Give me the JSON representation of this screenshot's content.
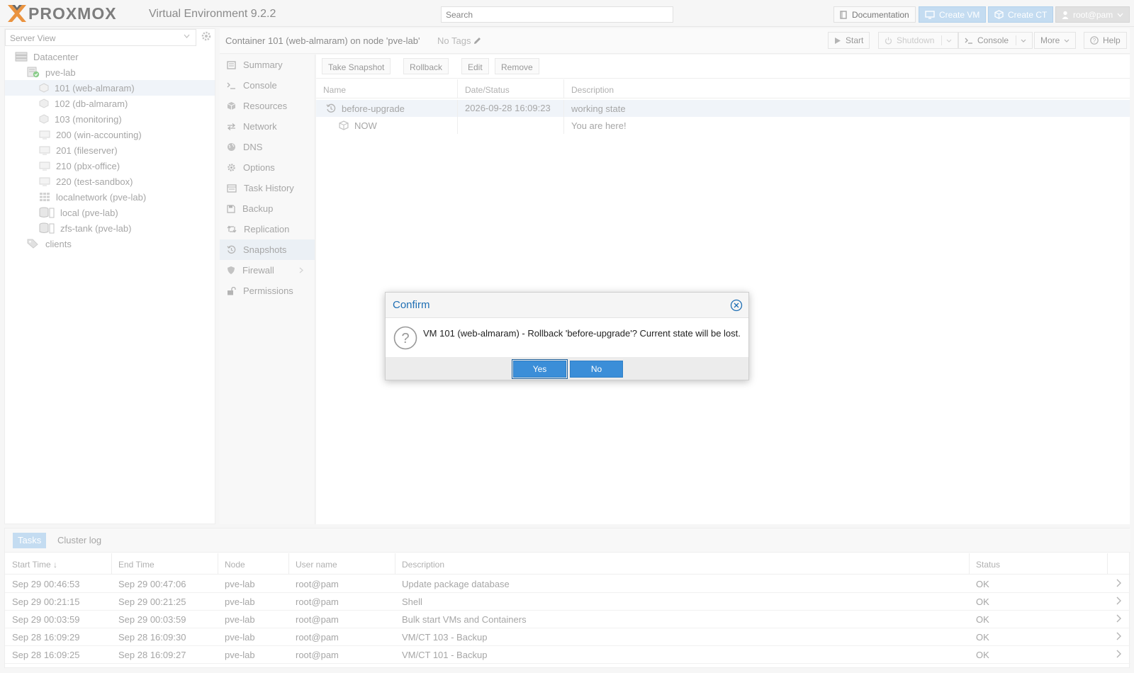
{
  "topbar": {
    "logo": "PROXMOX",
    "version": "Virtual Environment 9.2.2",
    "search_placeholder": "Search",
    "documentation": "Documentation",
    "create_vm": "Create VM",
    "create_ct": "Create CT",
    "user": "root@pam"
  },
  "left": {
    "view": "Server View",
    "tree": [
      {
        "label": "Datacenter",
        "icon": "datacenter-icon"
      },
      {
        "label": "pve-lab",
        "icon": "node-online-icon"
      },
      {
        "label": "101 (web-almaram)",
        "icon": "container-icon",
        "selected": true
      },
      {
        "label": "102 (db-almaram)",
        "icon": "container-icon"
      },
      {
        "label": "103 (monitoring)",
        "icon": "container-icon"
      },
      {
        "label": "200 (win-accounting)",
        "icon": "vm-icon"
      },
      {
        "label": "201 (fileserver)",
        "icon": "vm-icon"
      },
      {
        "label": "210 (pbx-office)",
        "icon": "vm-icon"
      },
      {
        "label": "220 (test-sandbox)",
        "icon": "vm-icon"
      },
      {
        "label": "localnetwork (pve-lab)",
        "icon": "sdn-icon"
      },
      {
        "label": "local (pve-lab)",
        "icon": "storage-icon"
      },
      {
        "label": "zfs-tank (pve-lab)",
        "icon": "storage-icon"
      },
      {
        "label": "clients",
        "icon": "tag-icon"
      }
    ]
  },
  "header": {
    "title": "Container 101 (web-almaram) on node 'pve-lab'",
    "no_tags": "No Tags",
    "start": "Start",
    "shutdown": "Shutdown",
    "console": "Console",
    "more": "More",
    "help": "Help"
  },
  "nav": [
    {
      "label": "Summary",
      "icon": "summary-icon"
    },
    {
      "label": "Console",
      "icon": "terminal-icon"
    },
    {
      "label": "Resources",
      "icon": "cube-icon"
    },
    {
      "label": "Network",
      "icon": "network-icon"
    },
    {
      "label": "DNS",
      "icon": "globe-icon"
    },
    {
      "label": "Options",
      "icon": "gear-icon"
    },
    {
      "label": "Task History",
      "icon": "list-icon"
    },
    {
      "label": "Backup",
      "icon": "floppy-icon"
    },
    {
      "label": "Replication",
      "icon": "retweet-icon"
    },
    {
      "label": "Snapshots",
      "icon": "history-icon",
      "active": true
    },
    {
      "label": "Firewall",
      "icon": "shield-icon"
    },
    {
      "label": "Permissions",
      "icon": "unlock-icon"
    }
  ],
  "snapshots": {
    "toolbar": {
      "take": "Take Snapshot",
      "rollback": "Rollback",
      "edit": "Edit",
      "remove": "Remove"
    },
    "columns": {
      "name": "Name",
      "date": "Date/Status",
      "description": "Description"
    },
    "rows": [
      {
        "name": "before-upgrade",
        "date": "2026-09-28 16:09:23",
        "description": "working state"
      },
      {
        "name": "NOW",
        "date": "",
        "description": "You are here!"
      }
    ]
  },
  "tasks": {
    "tabs": {
      "tasks": "Tasks",
      "cluster_log": "Cluster log"
    },
    "columns": {
      "start": "Start Time",
      "end": "End Time",
      "node": "Node",
      "user": "User name",
      "description": "Description",
      "status": "Status"
    },
    "rows": [
      {
        "start": "Sep 29 00:46:53",
        "end": "Sep 29 00:47:06",
        "node": "pve-lab",
        "user": "root@pam",
        "description": "Update package database",
        "status": "OK"
      },
      {
        "start": "Sep 29 00:21:15",
        "end": "Sep 29 00:21:25",
        "node": "pve-lab",
        "user": "root@pam",
        "description": "Shell",
        "status": "OK"
      },
      {
        "start": "Sep 29 00:03:59",
        "end": "Sep 29 00:03:59",
        "node": "pve-lab",
        "user": "root@pam",
        "description": "Bulk start VMs and Containers",
        "status": "OK"
      },
      {
        "start": "Sep 28 16:09:29",
        "end": "Sep 28 16:09:30",
        "node": "pve-lab",
        "user": "root@pam",
        "description": "VM/CT 103 - Backup",
        "status": "OK"
      },
      {
        "start": "Sep 28 16:09:25",
        "end": "Sep 28 16:09:27",
        "node": "pve-lab",
        "user": "root@pam",
        "description": "VM/CT 101 - Backup",
        "status": "OK"
      }
    ]
  },
  "dialog": {
    "title": "Confirm",
    "message": "VM 101 (web-almaram) - Rollback 'before-upgrade'? Current state will be lost.",
    "yes": "Yes",
    "no": "No"
  },
  "colors": {
    "accent": "#3b8ed8",
    "brand_orange": "#e57000",
    "title_blue": "#1f6fb4"
  }
}
